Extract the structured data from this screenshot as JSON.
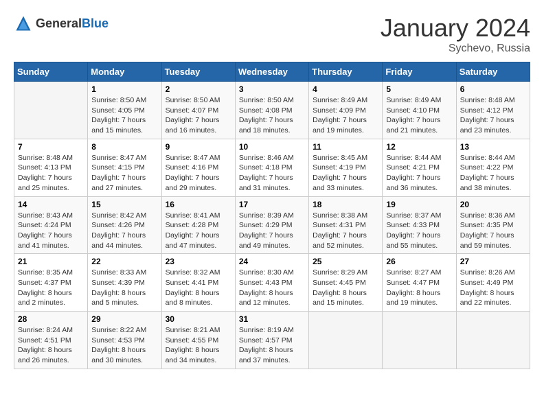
{
  "header": {
    "logo_general": "General",
    "logo_blue": "Blue",
    "title": "January 2024",
    "subtitle": "Sychevo, Russia"
  },
  "weekdays": [
    "Sunday",
    "Monday",
    "Tuesday",
    "Wednesday",
    "Thursday",
    "Friday",
    "Saturday"
  ],
  "weeks": [
    [
      {
        "day": "",
        "info": ""
      },
      {
        "day": "1",
        "info": "Sunrise: 8:50 AM\nSunset: 4:05 PM\nDaylight: 7 hours\nand 15 minutes."
      },
      {
        "day": "2",
        "info": "Sunrise: 8:50 AM\nSunset: 4:07 PM\nDaylight: 7 hours\nand 16 minutes."
      },
      {
        "day": "3",
        "info": "Sunrise: 8:50 AM\nSunset: 4:08 PM\nDaylight: 7 hours\nand 18 minutes."
      },
      {
        "day": "4",
        "info": "Sunrise: 8:49 AM\nSunset: 4:09 PM\nDaylight: 7 hours\nand 19 minutes."
      },
      {
        "day": "5",
        "info": "Sunrise: 8:49 AM\nSunset: 4:10 PM\nDaylight: 7 hours\nand 21 minutes."
      },
      {
        "day": "6",
        "info": "Sunrise: 8:48 AM\nSunset: 4:12 PM\nDaylight: 7 hours\nand 23 minutes."
      }
    ],
    [
      {
        "day": "7",
        "info": "Sunrise: 8:48 AM\nSunset: 4:13 PM\nDaylight: 7 hours\nand 25 minutes."
      },
      {
        "day": "8",
        "info": "Sunrise: 8:47 AM\nSunset: 4:15 PM\nDaylight: 7 hours\nand 27 minutes."
      },
      {
        "day": "9",
        "info": "Sunrise: 8:47 AM\nSunset: 4:16 PM\nDaylight: 7 hours\nand 29 minutes."
      },
      {
        "day": "10",
        "info": "Sunrise: 8:46 AM\nSunset: 4:18 PM\nDaylight: 7 hours\nand 31 minutes."
      },
      {
        "day": "11",
        "info": "Sunrise: 8:45 AM\nSunset: 4:19 PM\nDaylight: 7 hours\nand 33 minutes."
      },
      {
        "day": "12",
        "info": "Sunrise: 8:44 AM\nSunset: 4:21 PM\nDaylight: 7 hours\nand 36 minutes."
      },
      {
        "day": "13",
        "info": "Sunrise: 8:44 AM\nSunset: 4:22 PM\nDaylight: 7 hours\nand 38 minutes."
      }
    ],
    [
      {
        "day": "14",
        "info": "Sunrise: 8:43 AM\nSunset: 4:24 PM\nDaylight: 7 hours\nand 41 minutes."
      },
      {
        "day": "15",
        "info": "Sunrise: 8:42 AM\nSunset: 4:26 PM\nDaylight: 7 hours\nand 44 minutes."
      },
      {
        "day": "16",
        "info": "Sunrise: 8:41 AM\nSunset: 4:28 PM\nDaylight: 7 hours\nand 47 minutes."
      },
      {
        "day": "17",
        "info": "Sunrise: 8:39 AM\nSunset: 4:29 PM\nDaylight: 7 hours\nand 49 minutes."
      },
      {
        "day": "18",
        "info": "Sunrise: 8:38 AM\nSunset: 4:31 PM\nDaylight: 7 hours\nand 52 minutes."
      },
      {
        "day": "19",
        "info": "Sunrise: 8:37 AM\nSunset: 4:33 PM\nDaylight: 7 hours\nand 55 minutes."
      },
      {
        "day": "20",
        "info": "Sunrise: 8:36 AM\nSunset: 4:35 PM\nDaylight: 7 hours\nand 59 minutes."
      }
    ],
    [
      {
        "day": "21",
        "info": "Sunrise: 8:35 AM\nSunset: 4:37 PM\nDaylight: 8 hours\nand 2 minutes."
      },
      {
        "day": "22",
        "info": "Sunrise: 8:33 AM\nSunset: 4:39 PM\nDaylight: 8 hours\nand 5 minutes."
      },
      {
        "day": "23",
        "info": "Sunrise: 8:32 AM\nSunset: 4:41 PM\nDaylight: 8 hours\nand 8 minutes."
      },
      {
        "day": "24",
        "info": "Sunrise: 8:30 AM\nSunset: 4:43 PM\nDaylight: 8 hours\nand 12 minutes."
      },
      {
        "day": "25",
        "info": "Sunrise: 8:29 AM\nSunset: 4:45 PM\nDaylight: 8 hours\nand 15 minutes."
      },
      {
        "day": "26",
        "info": "Sunrise: 8:27 AM\nSunset: 4:47 PM\nDaylight: 8 hours\nand 19 minutes."
      },
      {
        "day": "27",
        "info": "Sunrise: 8:26 AM\nSunset: 4:49 PM\nDaylight: 8 hours\nand 22 minutes."
      }
    ],
    [
      {
        "day": "28",
        "info": "Sunrise: 8:24 AM\nSunset: 4:51 PM\nDaylight: 8 hours\nand 26 minutes."
      },
      {
        "day": "29",
        "info": "Sunrise: 8:22 AM\nSunset: 4:53 PM\nDaylight: 8 hours\nand 30 minutes."
      },
      {
        "day": "30",
        "info": "Sunrise: 8:21 AM\nSunset: 4:55 PM\nDaylight: 8 hours\nand 34 minutes."
      },
      {
        "day": "31",
        "info": "Sunrise: 8:19 AM\nSunset: 4:57 PM\nDaylight: 8 hours\nand 37 minutes."
      },
      {
        "day": "",
        "info": ""
      },
      {
        "day": "",
        "info": ""
      },
      {
        "day": "",
        "info": ""
      }
    ]
  ]
}
